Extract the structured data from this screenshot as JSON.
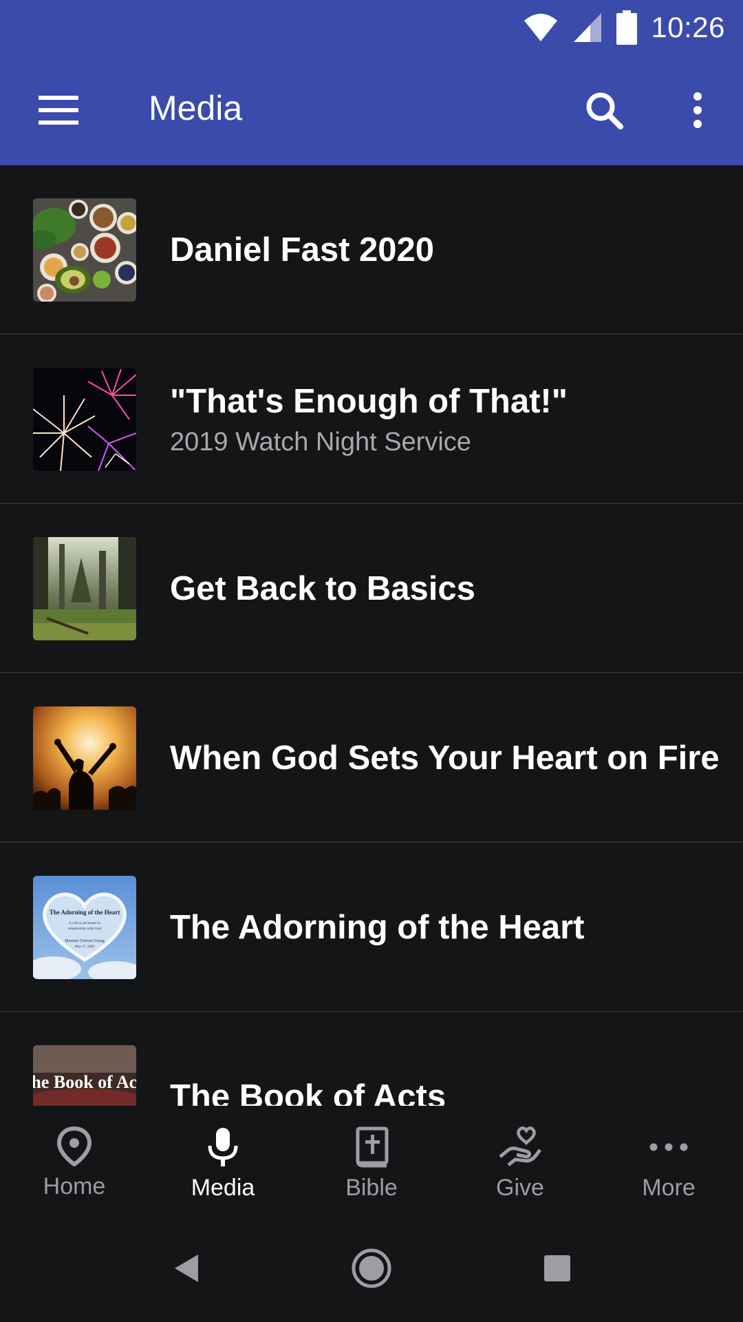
{
  "status": {
    "time": "10:26"
  },
  "appbar": {
    "title": "Media"
  },
  "items": [
    {
      "title": "Daniel Fast 2020",
      "subtitle": "",
      "thumb": "healthy-food-bowls"
    },
    {
      "title": "\"That's Enough of That!\"",
      "subtitle": "2019 Watch Night Service",
      "thumb": "fireworks"
    },
    {
      "title": "Get Back to Basics",
      "subtitle": "",
      "thumb": "forest"
    },
    {
      "title": "When God Sets Your Heart on Fire",
      "subtitle": "",
      "thumb": "worship-fire"
    },
    {
      "title": "The Adorning of the Heart",
      "subtitle": "",
      "thumb": "cloud-heart"
    },
    {
      "title": "The Book of Acts",
      "subtitle": "",
      "thumb": "book-of-acts"
    }
  ],
  "thumb_text": {
    "heart_title": "The Adorning of the Heart",
    "heart_line1": "A call to set hearts in",
    "heart_line2": "relationship with God",
    "heart_speaker": "Minister Trelwin Young",
    "heart_date": "May 17, 2020",
    "acts_text": "The Book of Acts"
  },
  "bottom_nav": [
    {
      "label": "Home",
      "icon": "location-pin-icon",
      "active": false
    },
    {
      "label": "Media",
      "icon": "microphone-icon",
      "active": true
    },
    {
      "label": "Bible",
      "icon": "bible-icon",
      "active": false
    },
    {
      "label": "Give",
      "icon": "give-heart-hand-icon",
      "active": false
    },
    {
      "label": "More",
      "icon": "more-dots-icon",
      "active": false
    }
  ],
  "colors": {
    "appbar": "#3b4bab",
    "background": "#141517",
    "divider": "#2a2c30",
    "inactive": "#9c9ea3",
    "subtitle": "#a8a9ac"
  }
}
